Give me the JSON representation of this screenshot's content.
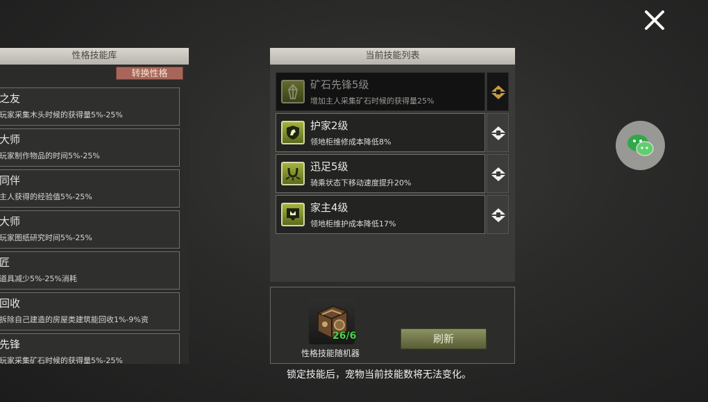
{
  "left_panel": {
    "header": "性格技能库",
    "convert_button": "转换性格",
    "items": [
      {
        "name": "之友",
        "desc": "玩家采集木头时候的获得量5%-25%"
      },
      {
        "name": "大师",
        "desc": "玩家制作物品的时间5%-25%"
      },
      {
        "name": "同伴",
        "desc": "主人获得的经验值5%-25%"
      },
      {
        "name": "大师",
        "desc": "玩家图纸研究时间5%-25%"
      },
      {
        "name": "匠",
        "desc": "道具减少5%-25%消耗"
      },
      {
        "name": "回收",
        "desc": "拆除自己建造的房屋类建筑能回收1%-9%资"
      },
      {
        "name": "先锋",
        "desc": "玩家采集矿石时候的获得量5%-25%"
      }
    ]
  },
  "right_panel": {
    "header": "当前技能列表",
    "skills": [
      {
        "name": "矿石先锋5级",
        "desc": "增加主人采集矿石时候的获得量25%",
        "locked": true,
        "icon": "crystal-icon"
      },
      {
        "name": "护家2级",
        "desc": "领地柜维修成本降低8%",
        "locked": false,
        "icon": "shield-icon"
      },
      {
        "name": "迅足5级",
        "desc": "骑乘状态下移动速度提升20%",
        "locked": false,
        "icon": "horseshoe-icon"
      },
      {
        "name": "家主4级",
        "desc": "领地柜维护成本降低17%",
        "locked": false,
        "icon": "banner-icon"
      }
    ]
  },
  "bottom_panel": {
    "randomizer_count": "26/6",
    "randomizer_label": "性格技能随机器",
    "refresh_button": "刷新"
  },
  "warning_text": "锁定技能后，宠物当前技能数将无法变化。",
  "colors": {
    "header_bg": "#c9c6bd",
    "convert_button": "#a8665a",
    "refresh_button": "#7a7e4c",
    "skill_icon": "#8fa033",
    "count_text": "#4fd24f"
  }
}
